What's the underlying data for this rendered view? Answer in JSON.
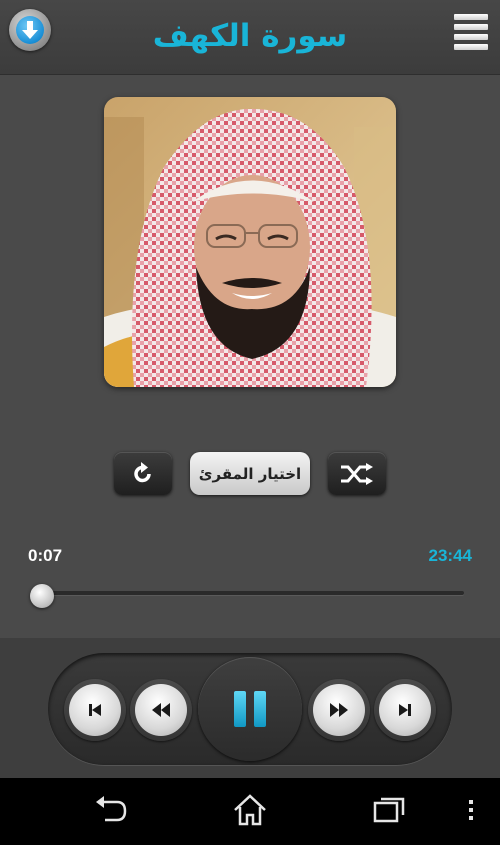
{
  "header": {
    "title": "سورة الكهف",
    "download_icon": "download-arrow-icon",
    "menu_icon": "hamburger-menu-icon"
  },
  "reciter": {
    "photo_alt": "reciter-portrait"
  },
  "controls": {
    "repeat_icon": "repeat-icon",
    "choose_reciter_label": "اختيار المقرئ",
    "shuffle_icon": "shuffle-icon"
  },
  "progress": {
    "elapsed": "0:07",
    "total": "23:44",
    "fraction": 0.005
  },
  "player": {
    "prev_track_icon": "skip-previous-icon",
    "rewind_icon": "rewind-icon",
    "pause_icon": "pause-icon",
    "fast_forward_icon": "fast-forward-icon",
    "next_track_icon": "skip-next-icon"
  },
  "system_nav": {
    "back_icon": "back-icon",
    "home_icon": "home-icon",
    "recents_icon": "recent-apps-icon",
    "overflow_icon": "overflow-menu-icon"
  },
  "colors": {
    "accent": "#19b5d8",
    "background": "#4a4a4a"
  }
}
